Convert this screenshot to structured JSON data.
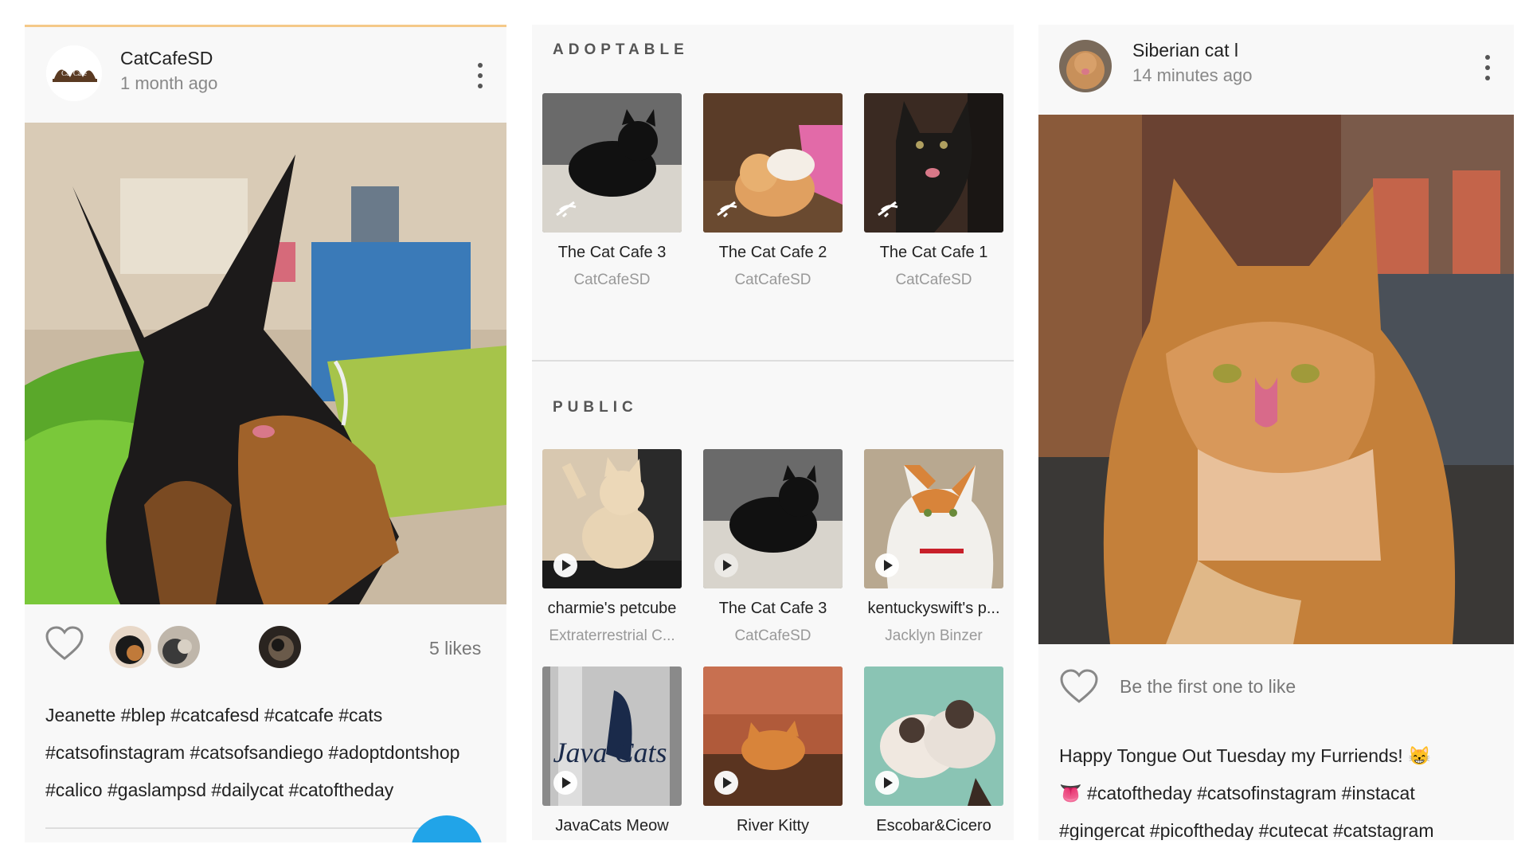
{
  "left_post": {
    "user": "CatCafeSD",
    "time": "1 month ago",
    "avatar_logo_text": "Cat Cafe",
    "likes": "5 likes",
    "caption_lines": [
      "Jeanette #blep #catcafesd #catcafe #cats",
      "#catsofinstagram #catsofsandiego #adoptdontshop",
      "#calico #gaslampsd #dailycat #catoftheday"
    ],
    "accent_color": "#21a4e8"
  },
  "adoptable": {
    "title": "ADOPTABLE",
    "items": [
      {
        "title": "The Cat Cafe 3",
        "owner": "CatCafeSD"
      },
      {
        "title": "The Cat Cafe 2",
        "owner": "CatCafeSD"
      },
      {
        "title": "The Cat Cafe 1",
        "owner": "CatCafeSD"
      }
    ]
  },
  "public": {
    "title": "PUBLIC",
    "items": [
      {
        "title": "charmie's petcube",
        "owner": "Extraterrestrial C..."
      },
      {
        "title": "The Cat Cafe 3",
        "owner": "CatCafeSD"
      },
      {
        "title": "kentuckyswift's p...",
        "owner": "Jacklyn Binzer"
      },
      {
        "title": "JavaCats Meow",
        "owner": ""
      },
      {
        "title": "River Kitty",
        "owner": ""
      },
      {
        "title": "Escobar&Cicero",
        "owner": ""
      }
    ]
  },
  "right_post": {
    "user": "Siberian cat l",
    "time": "14 minutes ago",
    "like_prompt": "Be the first one to like",
    "caption_lines": [
      "Happy Tongue Out Tuesday my Furriends! 😸",
      "👅 #catoftheday #catsofinstagram #instacat",
      "#gingercat #picoftheday #cutecat #catstagram"
    ]
  },
  "icons": [
    "more-vert-icon",
    "heart-outline-icon",
    "play-icon",
    "offline-camera-icon"
  ]
}
